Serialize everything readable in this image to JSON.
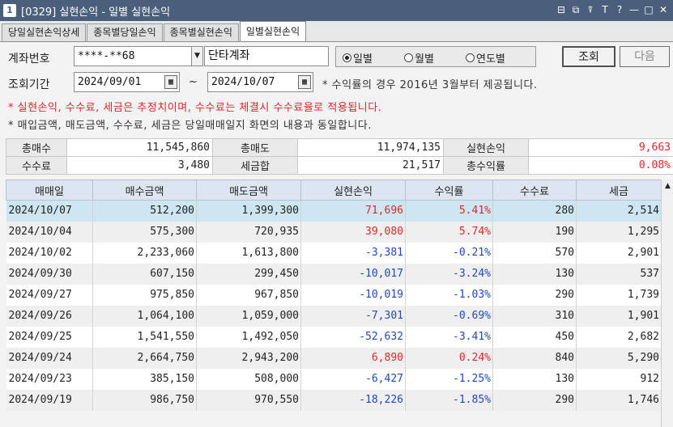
{
  "window": {
    "icon_text": "1",
    "title": "[0329] 실현손익 - 일별 실현손익",
    "buttons": [
      "⊟",
      "⧉",
      "⍒",
      "T",
      "?",
      "—",
      "□",
      "✕"
    ]
  },
  "tabs": [
    {
      "label": "당일실현손익상세",
      "active": false
    },
    {
      "label": "종목별당일손익",
      "active": false
    },
    {
      "label": "종목별실현손익",
      "active": false
    },
    {
      "label": "일별실현손익",
      "active": true
    }
  ],
  "form": {
    "account_label": "계좌번호",
    "account_value": "****-**68",
    "account_name": "단타계좌",
    "period_label": "조회기간",
    "date_from": "2024/09/01",
    "date_to": "2024/10/07",
    "tilde": "~",
    "period_note": "* 수익률의 경우 2016년 3월부터 제공됩니다.",
    "radios": [
      {
        "label": "일별",
        "checked": true
      },
      {
        "label": "월별",
        "checked": false
      },
      {
        "label": "연도별",
        "checked": false
      }
    ],
    "search_button": "조회",
    "next_button": "다음"
  },
  "notes": {
    "warning": "* 실현손익, 수수료, 세금은 추정치이며, 수수료는 체결시 수수료율로 적용됩니다.",
    "info": "* 매입금액, 매도금액, 수수료, 세금은 당일매매일지 화면의 내용과 동일합니다."
  },
  "summary": {
    "total_buy_label": "총매수",
    "total_buy": "11,545,860",
    "total_sell_label": "총매도",
    "total_sell": "11,974,135",
    "realized_label": "실현손익",
    "realized": "9,663",
    "fee_label": "수수료",
    "fee": "3,480",
    "tax_label": "세금합",
    "tax": "21,517",
    "return_label": "총수익률",
    "return": "0.08%"
  },
  "colors": {
    "positive": "#e0262a",
    "negative": "#2248b8",
    "selected_row": "#cde6f2"
  },
  "grid": {
    "columns": [
      "매매일",
      "매수금액",
      "매도금액",
      "실현손익",
      "수익률",
      "수수료",
      "세금"
    ],
    "rows": [
      {
        "date": "2024/10/07",
        "buy": "512,200",
        "sell": "1,399,300",
        "pnl": "71,696",
        "rate": "5.41%",
        "fee": "280",
        "tax": "2,514",
        "sign": "pos",
        "selected": true
      },
      {
        "date": "2024/10/04",
        "buy": "575,300",
        "sell": "720,935",
        "pnl": "39,080",
        "rate": "5.74%",
        "fee": "190",
        "tax": "1,295",
        "sign": "pos"
      },
      {
        "date": "2024/10/02",
        "buy": "2,233,060",
        "sell": "1,613,800",
        "pnl": "-3,381",
        "rate": "-0.21%",
        "fee": "570",
        "tax": "2,901",
        "sign": "neg"
      },
      {
        "date": "2024/09/30",
        "buy": "607,150",
        "sell": "299,450",
        "pnl": "-10,017",
        "rate": "-3.24%",
        "fee": "130",
        "tax": "537",
        "sign": "neg"
      },
      {
        "date": "2024/09/27",
        "buy": "975,850",
        "sell": "967,850",
        "pnl": "-10,019",
        "rate": "-1.03%",
        "fee": "290",
        "tax": "1,739",
        "sign": "neg"
      },
      {
        "date": "2024/09/26",
        "buy": "1,064,100",
        "sell": "1,059,000",
        "pnl": "-7,301",
        "rate": "-0.69%",
        "fee": "310",
        "tax": "1,901",
        "sign": "neg"
      },
      {
        "date": "2024/09/25",
        "buy": "1,541,550",
        "sell": "1,492,050",
        "pnl": "-52,632",
        "rate": "-3.41%",
        "fee": "450",
        "tax": "2,682",
        "sign": "neg"
      },
      {
        "date": "2024/09/24",
        "buy": "2,664,750",
        "sell": "2,943,200",
        "pnl": "6,890",
        "rate": "0.24%",
        "fee": "840",
        "tax": "5,290",
        "sign": "pos"
      },
      {
        "date": "2024/09/23",
        "buy": "385,150",
        "sell": "508,000",
        "pnl": "-6,427",
        "rate": "-1.25%",
        "fee": "130",
        "tax": "912",
        "sign": "neg"
      },
      {
        "date": "2024/09/19",
        "buy": "986,750",
        "sell": "970,550",
        "pnl": "-18,226",
        "rate": "-1.85%",
        "fee": "290",
        "tax": "1,746",
        "sign": "neg"
      }
    ]
  }
}
